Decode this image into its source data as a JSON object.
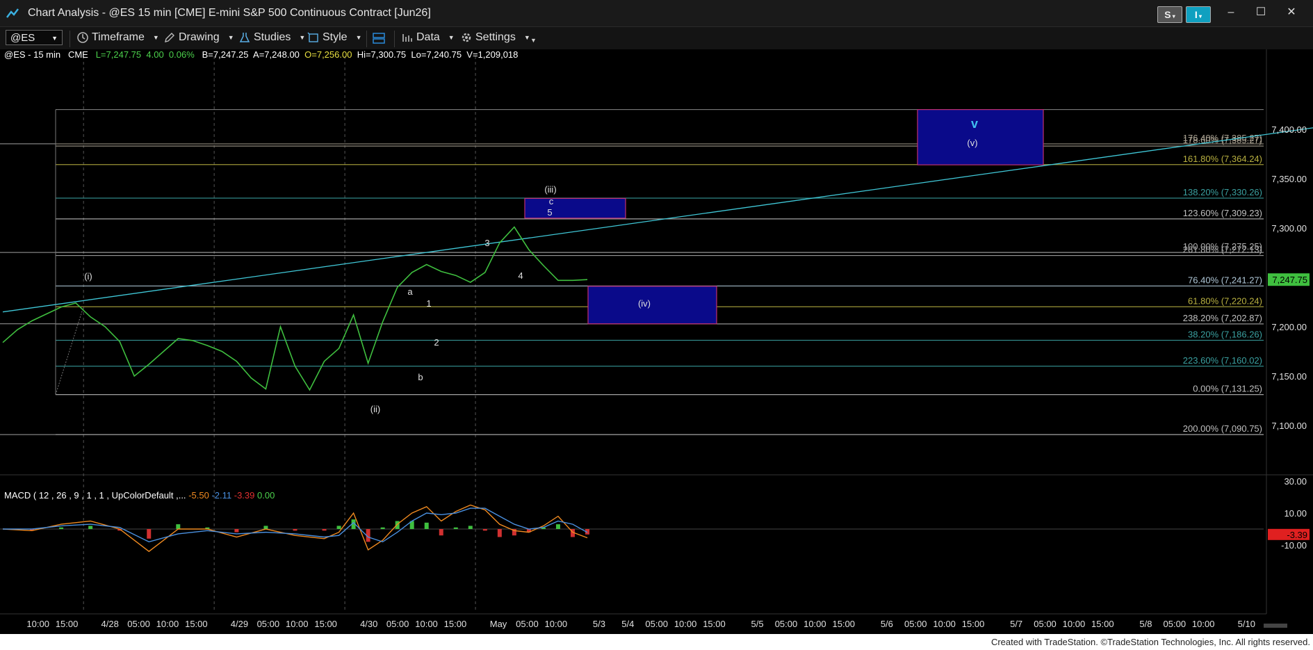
{
  "window": {
    "title": "Chart Analysis - @ES 15 min [CME] E-mini S&P 500 Continuous Contract [Jun26]",
    "s_button": "S",
    "i_button": "I",
    "minimize": "–",
    "maximize": "☐",
    "close": "✕"
  },
  "toolbar": {
    "symbol": "@ES",
    "timeframe": "Timeframe",
    "drawing": "Drawing",
    "studies": "Studies",
    "style": "Style",
    "data": "Data",
    "settings": "Settings"
  },
  "info_line": {
    "symbol": "@ES - 15 min",
    "exchange": "CME",
    "last": "L=7,247.75",
    "change": "4.00",
    "change_pct": "0.06%",
    "bid": "B=7,247.25",
    "ask": "A=7,248.00",
    "open": "O=7,256.00",
    "high": "Hi=7,300.75",
    "low": "Lo=7,240.75",
    "volume": "V=1,209,018"
  },
  "macd_line": {
    "label": "MACD ( 12 , 26 , 9 , 1 , 1 , UpColorDefault ,...",
    "macd": "-5.50",
    "signal": "-2.11",
    "hist": "-3.39",
    "zero": "0.00"
  },
  "price_axis": {
    "ticks": [
      {
        "value": 7400,
        "label": "7,400.00"
      },
      {
        "value": 7350,
        "label": "7,350.00"
      },
      {
        "value": 7300,
        "label": "7,300.00"
      },
      {
        "value": 7200,
        "label": "7,200.00"
      },
      {
        "value": 7150,
        "label": "7,150.00"
      },
      {
        "value": 7100,
        "label": "7,100.00"
      }
    ],
    "last_price_label": "7,247.75",
    "last_price": 7247.75
  },
  "macd_axis": {
    "ticks": [
      {
        "value": 30,
        "label": "30.00"
      },
      {
        "value": 10,
        "label": "10.00"
      },
      {
        "value": -10,
        "label": "-10.00"
      }
    ],
    "current_label": "-3.39",
    "current": -3.39
  },
  "fib_levels": [
    {
      "label": "176.40% (7,385.27)",
      "price": 7385.27,
      "color": "#a8a090"
    },
    {
      "label": "178.60% (7,385.27)",
      "price": 7383.0,
      "color": "#a8a090"
    },
    {
      "label": "161.80% (7,364.24)",
      "price": 7364.24,
      "color": "#b8b040"
    },
    {
      "label": "138.20% (7,330.26)",
      "price": 7330.26,
      "color": "#3aa0a0"
    },
    {
      "label": "123.60% (7,309.23)",
      "price": 7309.23,
      "color": "#c0c0c0"
    },
    {
      "label": "100.00% (7,275.25)",
      "price": 7275.25,
      "color": "#b0b0b0"
    },
    {
      "label": "261.80% (7,272.13)",
      "price": 7272.13,
      "color": "#b0b0b0"
    },
    {
      "label": "76.40% (7,241.27)",
      "price": 7241.27,
      "color": "#b0c8d8"
    },
    {
      "label": "61.80% (7,220.24)",
      "price": 7220.24,
      "color": "#b8b040"
    },
    {
      "label": "238.20% (7,202.87)",
      "price": 7202.87,
      "color": "#c0c0c0"
    },
    {
      "label": "38.20% (7,186.26)",
      "price": 7186.26,
      "color": "#3aa0a0"
    },
    {
      "label": "223.60% (7,160.02)",
      "price": 7160.02,
      "color": "#3aa0a0"
    },
    {
      "label": "0.00% (7,131.25)",
      "price": 7131.25,
      "color": "#c0c0c0"
    },
    {
      "label": "200.00% (7,090.75)",
      "price": 7090.75,
      "color": "#c0c0c0"
    }
  ],
  "time_axis": [
    {
      "bar": 2,
      "label": "10:00"
    },
    {
      "bar": 4,
      "label": "15:00"
    },
    {
      "bar": 7,
      "label": "4/28"
    },
    {
      "bar": 9,
      "label": "05:00"
    },
    {
      "bar": 11,
      "label": "10:00"
    },
    {
      "bar": 13,
      "label": "15:00"
    },
    {
      "bar": 16,
      "label": "4/29"
    },
    {
      "bar": 18,
      "label": "05:00"
    },
    {
      "bar": 20,
      "label": "10:00"
    },
    {
      "bar": 22,
      "label": "15:00"
    },
    {
      "bar": 25,
      "label": "4/30"
    },
    {
      "bar": 27,
      "label": "05:00"
    },
    {
      "bar": 29,
      "label": "10:00"
    },
    {
      "bar": 31,
      "label": "15:00"
    },
    {
      "bar": 34,
      "label": "May"
    },
    {
      "bar": 36,
      "label": "05:00"
    },
    {
      "bar": 38,
      "label": "10:00"
    },
    {
      "bar": 41,
      "label": "5/3"
    },
    {
      "bar": 43,
      "label": "5/4"
    },
    {
      "bar": 45,
      "label": "05:00"
    },
    {
      "bar": 47,
      "label": "10:00"
    },
    {
      "bar": 49,
      "label": "15:00"
    },
    {
      "bar": 52,
      "label": "5/5"
    },
    {
      "bar": 54,
      "label": "05:00"
    },
    {
      "bar": 56,
      "label": "10:00"
    },
    {
      "bar": 58,
      "label": "15:00"
    },
    {
      "bar": 61,
      "label": "5/6"
    },
    {
      "bar": 63,
      "label": "05:00"
    },
    {
      "bar": 65,
      "label": "10:00"
    },
    {
      "bar": 67,
      "label": "15:00"
    },
    {
      "bar": 70,
      "label": "5/7"
    },
    {
      "bar": 72,
      "label": "05:00"
    },
    {
      "bar": 74,
      "label": "10:00"
    },
    {
      "bar": 76,
      "label": "15:00"
    },
    {
      "bar": 79,
      "label": "5/8"
    },
    {
      "bar": 81,
      "label": "05:00"
    },
    {
      "bar": 83,
      "label": "10:00"
    },
    {
      "bar": 86,
      "label": "5/10"
    }
  ],
  "chart_data": {
    "type": "line",
    "title": "@ES - 15 min",
    "xlabel": "",
    "ylabel": "",
    "ylim": [
      7060,
      7430
    ],
    "x_range_bars": [
      0,
      91
    ],
    "series": [
      {
        "name": "@ES",
        "color": "#3fbf3f",
        "x": [
          0,
          1,
          2,
          3,
          4,
          5,
          6,
          7,
          8,
          9,
          10,
          11,
          12,
          13,
          14,
          15,
          16,
          17,
          18,
          19,
          20,
          21,
          22,
          23,
          24,
          25,
          26,
          27,
          28,
          29,
          30,
          31,
          32,
          33,
          34,
          35,
          36,
          37,
          38,
          39,
          40
        ],
        "y": [
          7184,
          7197,
          7206,
          7213,
          7220,
          7224,
          7210,
          7200,
          7185,
          7150,
          7162,
          7175,
          7188,
          7186,
          7181,
          7175,
          7165,
          7148,
          7137,
          7200,
          7160,
          7136,
          7165,
          7178,
          7212,
          7163,
          7205,
          7240,
          7255,
          7263,
          7256,
          7252,
          7245,
          7255,
          7285,
          7301,
          7278,
          7262,
          7247,
          7247,
          7247.75
        ]
      }
    ],
    "wave_labels": [
      "(i)",
      "(ii)",
      "a",
      "b",
      "1",
      "2",
      "3",
      "4",
      "5",
      "c",
      "(iii)",
      "(iv)",
      "(v)",
      "v"
    ],
    "target_boxes": [
      {
        "label": "(iii)",
        "top": 7330,
        "bottom": 7310
      },
      {
        "label": "(iv)",
        "top": 7241,
        "bottom": 7203
      },
      {
        "label": "(v)",
        "top": 7420,
        "bottom": 7364
      }
    ],
    "trendline": {
      "from": [
        0,
        7215
      ],
      "to": [
        91,
        7403
      ]
    },
    "macd": {
      "name": "MACD",
      "x": [
        0,
        2,
        4,
        6,
        8,
        10,
        12,
        14,
        16,
        18,
        20,
        22,
        23,
        24,
        25,
        26,
        27,
        28,
        29,
        30,
        31,
        32,
        33,
        34,
        35,
        36,
        37,
        38,
        39,
        40
      ],
      "values": [
        0,
        -1,
        3,
        5,
        0,
        -14,
        0,
        0,
        -5,
        0,
        -4,
        -6,
        -2,
        10,
        -13,
        -7,
        3,
        10,
        14,
        5,
        11,
        15,
        12,
        3,
        -1,
        -2,
        2,
        8,
        -2,
        -5.5
      ],
      "signal": [
        0,
        0,
        2,
        3,
        1,
        -8,
        -3,
        -1,
        -3,
        -2,
        -3,
        -5,
        -4,
        4,
        -5,
        -8,
        -2,
        5,
        10,
        9,
        10,
        13,
        13,
        8,
        3,
        0,
        1,
        5,
        3,
        -2.11
      ]
    }
  },
  "footer": "Created with TradeStation. ©TradeStation Technologies, Inc. All rights reserved."
}
